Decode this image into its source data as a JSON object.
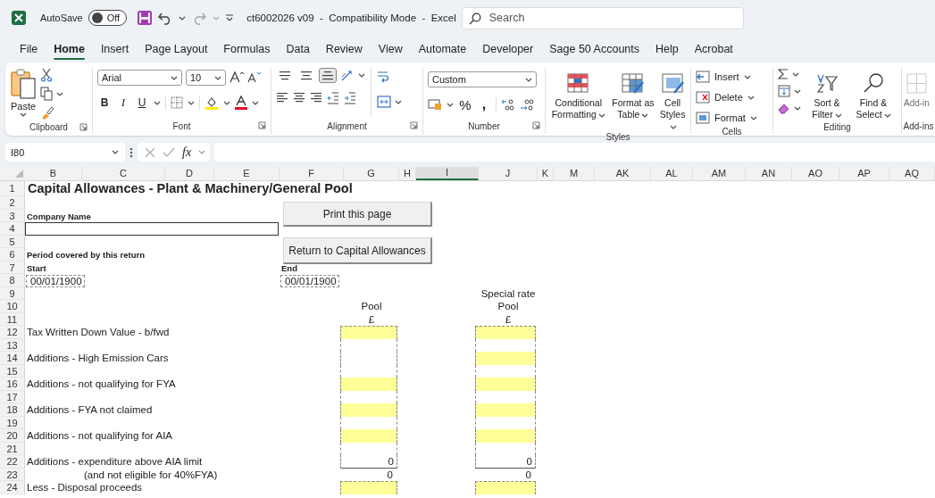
{
  "titlebar": {
    "autosave_label": "AutoSave",
    "autosave": {
      "on": false,
      "label": "Off"
    },
    "redo_disabled": true,
    "document_title": "ct6002026 v09  -  Compatibility Mode  -  Excel",
    "search": {
      "placeholder": "Search"
    }
  },
  "tabs": [
    {
      "label": "File",
      "selected": false
    },
    {
      "label": "Home",
      "selected": true
    },
    {
      "label": "Insert",
      "selected": false
    },
    {
      "label": "Page Layout",
      "selected": false
    },
    {
      "label": "Formulas",
      "selected": false
    },
    {
      "label": "Data",
      "selected": false
    },
    {
      "label": "Review",
      "selected": false
    },
    {
      "label": "View",
      "selected": false
    },
    {
      "label": "Automate",
      "selected": false
    },
    {
      "label": "Developer",
      "selected": false
    },
    {
      "label": "Sage 50 Accounts",
      "selected": false
    },
    {
      "label": "Help",
      "selected": false
    },
    {
      "label": "Acrobat",
      "selected": false
    }
  ],
  "ribbon": {
    "groups": [
      {
        "kind": "clipboard",
        "label": "Clipboard",
        "launcher": true,
        "paste": "Paste"
      },
      {
        "kind": "font",
        "label": "Font",
        "launcher": true,
        "font_name": "Arial",
        "font_size": "10",
        "format_buttons": [
          "B",
          "I",
          "U"
        ]
      },
      {
        "kind": "alignment",
        "label": "Alignment",
        "launcher": true,
        "vertical_align": [
          {
            "selected": false
          },
          {
            "selected": false
          },
          {
            "selected": true
          }
        ]
      },
      {
        "kind": "number",
        "label": "Number",
        "launcher": true,
        "format": "Custom",
        "symbols": [
          "%",
          ","
        ]
      },
      {
        "kind": "styles",
        "label": "Styles",
        "buttons": [
          "Conditional Formatting",
          "Format as Table",
          "Cell Styles"
        ]
      },
      {
        "kind": "cells",
        "label": "Cells",
        "buttons": [
          "Insert",
          "Delete",
          "Format"
        ]
      },
      {
        "kind": "editing",
        "label": "Editing",
        "buttons": [
          "Sort & Filter",
          "Find & Select"
        ]
      },
      {
        "kind": "addins",
        "label": "Add-ins",
        "buttons": [
          "Add-in"
        ],
        "disabled": true
      }
    ]
  },
  "formula_bar": {
    "name_box": "I80",
    "function_label": "fx"
  },
  "sheet": {
    "columns": [
      {
        "label": "B",
        "selected": false
      },
      {
        "label": "C",
        "selected": false
      },
      {
        "label": "D",
        "selected": false
      },
      {
        "label": "E",
        "selected": false
      },
      {
        "label": "F",
        "selected": false
      },
      {
        "label": "G",
        "selected": false
      },
      {
        "label": "H",
        "selected": false
      },
      {
        "label": "I",
        "selected": true
      },
      {
        "label": "J",
        "selected": false
      },
      {
        "label": "K",
        "selected": false
      },
      {
        "label": "M",
        "selected": false
      },
      {
        "label": "AK",
        "selected": false
      },
      {
        "label": "AL",
        "selected": false
      },
      {
        "label": "AM",
        "selected": false
      },
      {
        "label": "AN",
        "selected": false
      },
      {
        "label": "AO",
        "selected": false
      },
      {
        "label": "AP",
        "selected": false
      },
      {
        "label": "AQ",
        "selected": false
      }
    ],
    "buttons": [
      "Print this page",
      "Return to Capital Allowances"
    ],
    "rows": [
      {
        "number": "1",
        "cell_b": {
          "kind": "title",
          "text": "Capital Allowances - Plant & Machinery/General Pool"
        }
      },
      {
        "number": "2"
      },
      {
        "number": "3",
        "cell_b": {
          "kind": "label",
          "text": "Company Name"
        }
      },
      {
        "number": "4",
        "cell_b": {
          "kind": "entry"
        }
      },
      {
        "number": "5"
      },
      {
        "number": "6",
        "cell_b": {
          "kind": "label",
          "text": "Period covered by this return"
        }
      },
      {
        "number": "7",
        "cell_b": {
          "kind": "label",
          "text": "Start"
        },
        "cell_f": {
          "kind": "label",
          "text": "End"
        }
      },
      {
        "number": "8",
        "cell_b": {
          "kind": "date",
          "text": "00/01/1900"
        },
        "cell_f": {
          "kind": "date",
          "text": "00/01/1900"
        }
      },
      {
        "number": "9",
        "cell_j": {
          "kind": "heading",
          "text": "Special rate"
        }
      },
      {
        "number": "10",
        "cell_g": {
          "kind": "heading",
          "text": "Pool"
        },
        "cell_j": {
          "kind": "heading",
          "text": "Pool"
        }
      },
      {
        "number": "11",
        "cell_g": {
          "kind": "heading",
          "text": "£"
        },
        "cell_j": {
          "kind": "heading",
          "text": "£"
        }
      },
      {
        "number": "12",
        "cell_b": {
          "kind": "text",
          "text": "Tax Written Down Value - b/fwd"
        },
        "cell_g": {
          "kind": "input"
        },
        "cell_j": {
          "kind": "input"
        }
      },
      {
        "number": "13",
        "cell_g": {
          "kind": "blank"
        },
        "cell_j": {
          "kind": "blank"
        }
      },
      {
        "number": "14",
        "cell_b": {
          "kind": "text",
          "text": "Additions - High Emission Cars"
        },
        "cell_g": {
          "kind": "blank"
        },
        "cell_j": {
          "kind": "input"
        }
      },
      {
        "number": "15",
        "cell_g": {
          "kind": "blank"
        },
        "cell_j": {
          "kind": "blank"
        }
      },
      {
        "number": "16",
        "cell_b": {
          "kind": "text",
          "text": "Additions - not qualifying for FYA"
        },
        "cell_g": {
          "kind": "input"
        },
        "cell_j": {
          "kind": "input"
        }
      },
      {
        "number": "17",
        "cell_g": {
          "kind": "blank"
        },
        "cell_j": {
          "kind": "blank"
        }
      },
      {
        "number": "18",
        "cell_b": {
          "kind": "text",
          "text": "Additions - FYA not claimed"
        },
        "cell_g": {
          "kind": "input"
        },
        "cell_j": {
          "kind": "input"
        }
      },
      {
        "number": "19",
        "cell_g": {
          "kind": "blank"
        },
        "cell_j": {
          "kind": "blank"
        }
      },
      {
        "number": "20",
        "cell_b": {
          "kind": "text",
          "text": "Additions - not qualifying for AIA"
        },
        "cell_g": {
          "kind": "input"
        },
        "cell_j": {
          "kind": "input"
        }
      },
      {
        "number": "21",
        "cell_g": {
          "kind": "blank"
        },
        "cell_j": {
          "kind": "blank"
        }
      },
      {
        "number": "22",
        "cell_b": {
          "kind": "text",
          "text": "Additions - expenditure above AIA limit"
        },
        "cell_g": {
          "kind": "total",
          "text": "0"
        },
        "cell_j": {
          "kind": "total",
          "text": "0"
        }
      },
      {
        "number": "23",
        "cell_c": {
          "kind": "text",
          "text": "(and not eligible for 40%FYA)"
        },
        "cell_g": {
          "kind": "value",
          "text": "0"
        },
        "cell_j": {
          "kind": "value",
          "text": "0"
        }
      },
      {
        "number": "24",
        "cell_b": {
          "kind": "text",
          "text": "Less - Disposal proceeds"
        },
        "cell_g": {
          "kind": "input"
        },
        "cell_j": {
          "kind": "input"
        }
      }
    ]
  }
}
